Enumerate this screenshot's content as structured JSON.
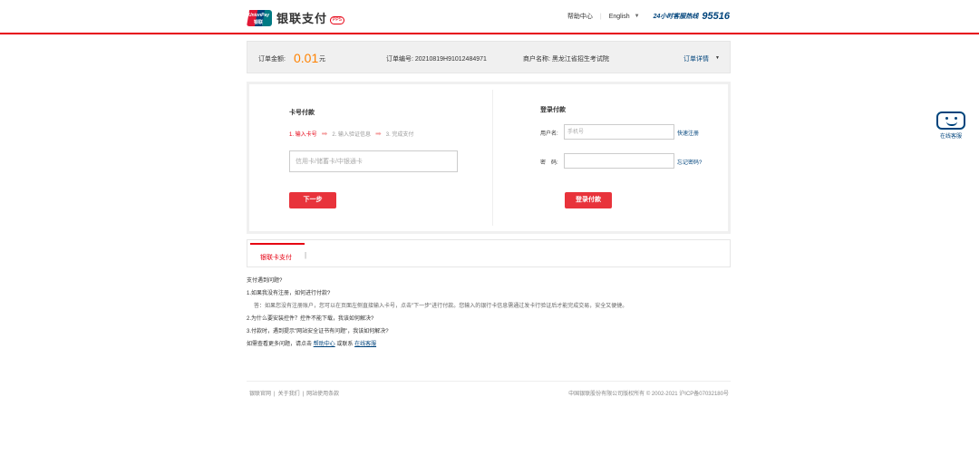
{
  "header": {
    "logo_top": "UnionPay",
    "logo_bottom": "银联",
    "brand": "银联支付",
    "badge": "PPS",
    "help": "帮助中心",
    "language": "English",
    "hotline_label": "24小时客服热线",
    "hotline_number": "95516"
  },
  "order": {
    "amount_label": "订单金额:",
    "amount": "0.01",
    "currency": "元",
    "order_no": "订单编号: 20210819H91012484971",
    "merchant": "商户名称: 黑龙江省招生考试院",
    "details": "订单详情"
  },
  "card_pay": {
    "title": "卡号付款",
    "step1": "1. 输入卡号",
    "step2": "2. 输入验证信息",
    "step3": "3. 完成支付",
    "placeholder": "信用卡/储蓄卡/中银通卡",
    "next": "下一步"
  },
  "login_pay": {
    "title": "登录付款",
    "username_label": "用户名:",
    "username_placeholder": "手机号",
    "register": "快速注册",
    "password_label": "密　码:",
    "forgot": "忘记密码?",
    "login": "登录付款"
  },
  "tabs": {
    "active": "银联卡支付",
    "sep": "|"
  },
  "faq": {
    "title": "支付遇到问题?",
    "q1": "1.如果我没有注册，如何进行付款?",
    "a1": "答：如果您没有注册账户，您可以在页面左侧直接输入卡号，点击\"下一步\"进行付款。您输入的银行卡信息需通过发卡行验证后才能完成交易，安全又便捷。",
    "q2": "2.为什么要安装控件？控件不能下载，我该如何解决?",
    "q3": "3.付款时，遇到提示\"网站安全证书有问题\"，我该如何解决?",
    "more_prefix": "如需查看更多问题，请点击",
    "more_help": "帮助中心",
    "more_mid": "或联系",
    "more_service": "在线客服"
  },
  "footer": {
    "link1": "银联官网",
    "link2": "关于我们",
    "link3": "网站使用条款",
    "copyright": "中国银联股份有限公司版权所有 © 2002-2021  沪ICP备07032180号"
  },
  "service": {
    "label": "在线客服"
  },
  "colors": {
    "brand_red": "#e60012",
    "brand_blue": "#00447c",
    "amount_orange": "#ff8200",
    "button_red": "#e8333b"
  }
}
